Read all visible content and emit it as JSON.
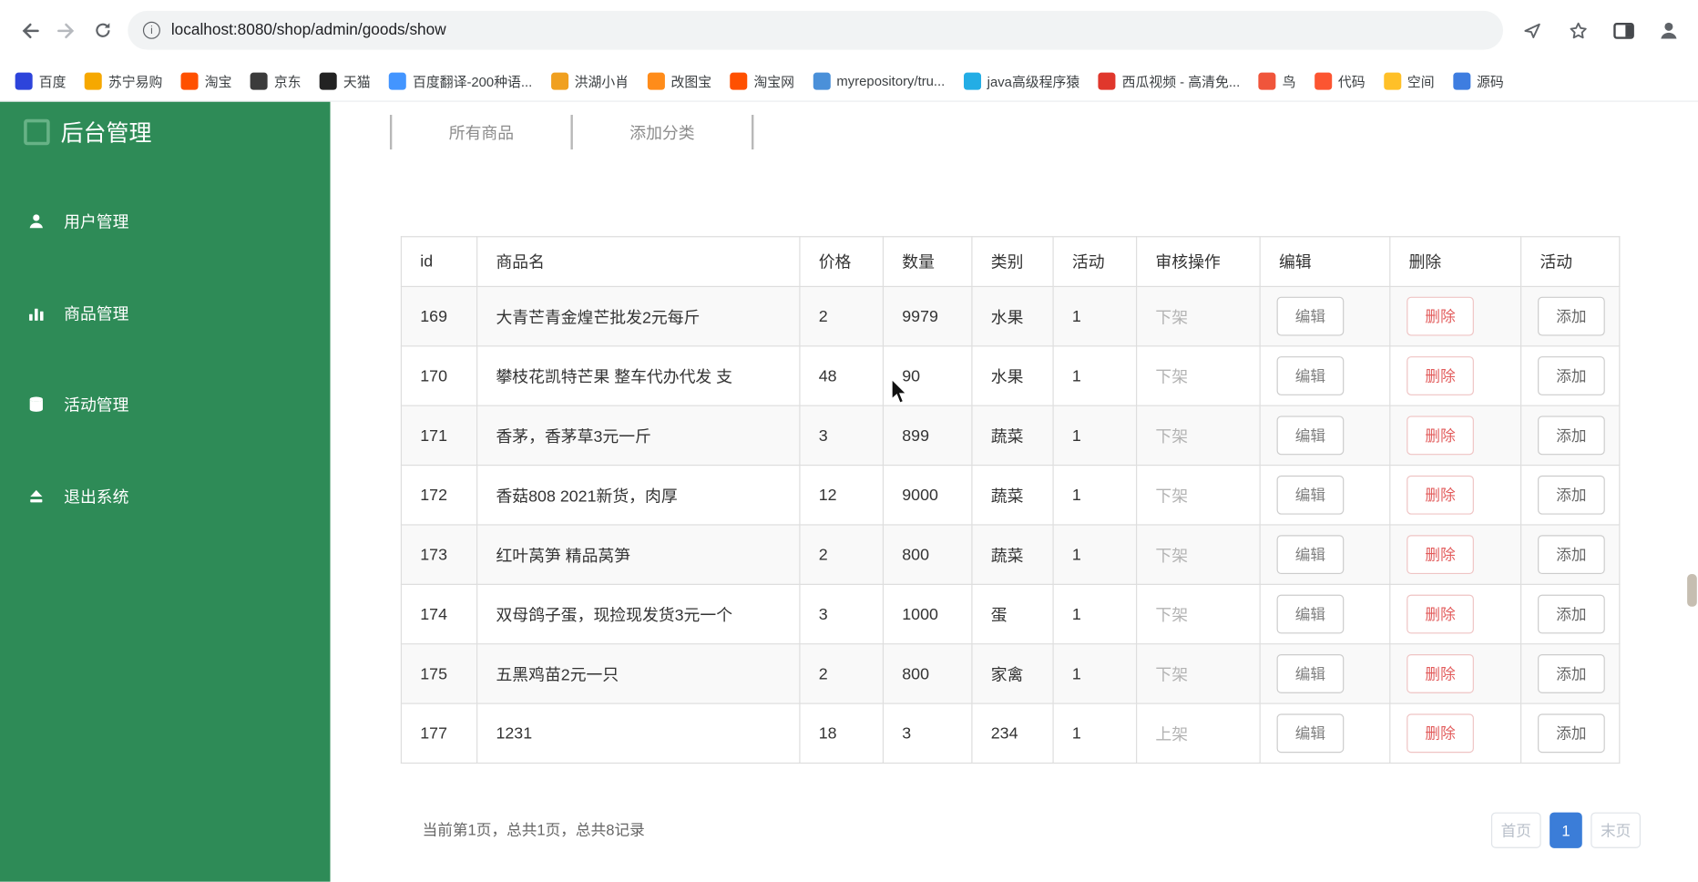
{
  "browser": {
    "url": "localhost:8080/shop/admin/goods/show",
    "bookmarks": [
      {
        "label": "百度",
        "color": "#2d44db"
      },
      {
        "label": "苏宁易购",
        "color": "#f6a800"
      },
      {
        "label": "淘宝",
        "color": "#ff5000"
      },
      {
        "label": "京东",
        "color": "#3b3b3b"
      },
      {
        "label": "天猫",
        "color": "#222222"
      },
      {
        "label": "百度翻译-200种语...",
        "color": "#4395ff"
      },
      {
        "label": "洪湖小肖",
        "color": "#f0a020"
      },
      {
        "label": "改图宝",
        "color": "#ff8c1a"
      },
      {
        "label": "淘宝网",
        "color": "#ff5000"
      },
      {
        "label": "myrepository/tru...",
        "color": "#4a90d9"
      },
      {
        "label": "java高级程序猿",
        "color": "#23ade5"
      },
      {
        "label": "西瓜视频 - 高清免...",
        "color": "#e0372c"
      },
      {
        "label": "鸟",
        "color": "#f0553b"
      },
      {
        "label": "代码",
        "color": "#fc5531"
      },
      {
        "label": "空间",
        "color": "#ffc028"
      },
      {
        "label": "源码",
        "color": "#3e7de0"
      }
    ]
  },
  "sidebar": {
    "title": "后台管理",
    "items": [
      {
        "label": "用户管理",
        "icon": "user-icon"
      },
      {
        "label": "商品管理",
        "icon": "bar-chart-icon"
      },
      {
        "label": "活动管理",
        "icon": "database-icon"
      },
      {
        "label": "退出系统",
        "icon": "eject-icon"
      }
    ]
  },
  "tabs": [
    {
      "label": "所有商品"
    },
    {
      "label": "添加分类"
    }
  ],
  "table": {
    "headers": [
      "id",
      "商品名",
      "价格",
      "数量",
      "类别",
      "活动",
      "审核操作",
      "编辑",
      "删除",
      "活动"
    ],
    "rows": [
      {
        "id": "169",
        "name": "大青芒青金煌芒批发2元每斤",
        "price": "2",
        "qty": "9979",
        "category": "水果",
        "activity": "1",
        "audit": "下架"
      },
      {
        "id": "170",
        "name": "攀枝花凯特芒果 整车代办代发 支",
        "price": "48",
        "qty": "90",
        "category": "水果",
        "activity": "1",
        "audit": "下架"
      },
      {
        "id": "171",
        "name": "香茅，香茅草3元一斤",
        "price": "3",
        "qty": "899",
        "category": "蔬菜",
        "activity": "1",
        "audit": "下架"
      },
      {
        "id": "172",
        "name": "香菇808 2021新货，肉厚",
        "price": "12",
        "qty": "9000",
        "category": "蔬菜",
        "activity": "1",
        "audit": "下架"
      },
      {
        "id": "173",
        "name": "红叶莴笋 精品莴笋",
        "price": "2",
        "qty": "800",
        "category": "蔬菜",
        "activity": "1",
        "audit": "下架"
      },
      {
        "id": "174",
        "name": "双母鸽子蛋，现捡现发货3元一个",
        "price": "3",
        "qty": "1000",
        "category": "蛋",
        "activity": "1",
        "audit": "下架"
      },
      {
        "id": "175",
        "name": "五黑鸡苗2元一只",
        "price": "2",
        "qty": "800",
        "category": "家禽",
        "activity": "1",
        "audit": "下架"
      },
      {
        "id": "177",
        "name": "1231",
        "price": "18",
        "qty": "3",
        "category": "234",
        "activity": "1",
        "audit": "上架"
      }
    ],
    "actions": {
      "edit": "编辑",
      "delete": "删除",
      "add": "添加"
    }
  },
  "footer": {
    "summary": "当前第1页，总共1页，总共8记录",
    "pagination": {
      "first": "首页",
      "current": "1",
      "last": "末页"
    }
  },
  "colors": {
    "sidebar_green": "#2e8b57",
    "delete_red": "#e25b5b",
    "pagination_blue": "#3b7dd8",
    "audit_gray": "#b3b3b3"
  }
}
